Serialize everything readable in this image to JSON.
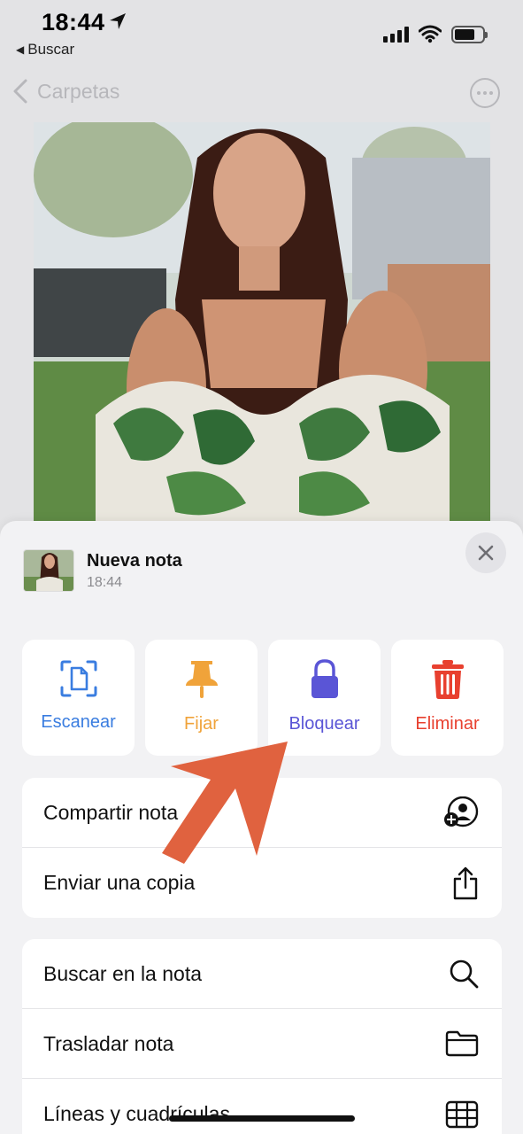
{
  "status_bar": {
    "time": "18:44",
    "back_app": "Buscar"
  },
  "nav": {
    "back_label": "Carpetas"
  },
  "note": {
    "title": "Nueva nota",
    "time": "18:44"
  },
  "actions": [
    {
      "label": "Escanear",
      "icon": "scan-document-icon",
      "color": "#3a7de0"
    },
    {
      "label": "Fijar",
      "icon": "pin-icon",
      "color": "#f0a33a"
    },
    {
      "label": "Bloquear",
      "icon": "lock-icon",
      "color": "#5a55d6"
    },
    {
      "label": "Eliminar",
      "icon": "trash-icon",
      "color": "#e8402f"
    }
  ],
  "menu_groups": [
    [
      {
        "label": "Compartir nota",
        "icon": "share-person-icon"
      },
      {
        "label": "Enviar una copia",
        "icon": "share-upload-icon"
      }
    ],
    [
      {
        "label": "Buscar en la nota",
        "icon": "search-icon"
      },
      {
        "label": "Trasladar nota",
        "icon": "folder-icon"
      },
      {
        "label": "Líneas y cuadrículas",
        "icon": "grid-icon"
      }
    ]
  ],
  "colors": {
    "annotation_arrow": "#e0623f",
    "sheet_bg": "#f2f2f4"
  }
}
